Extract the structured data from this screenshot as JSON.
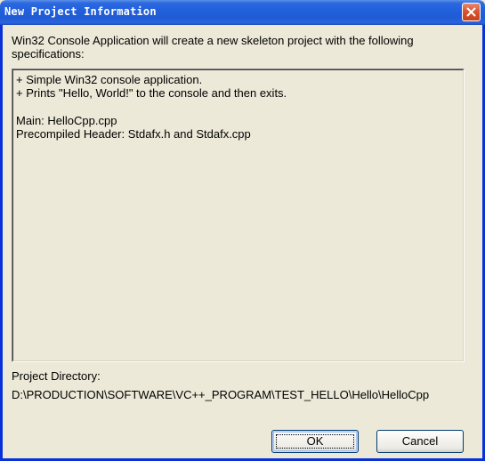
{
  "window": {
    "title": "New Project Information"
  },
  "intro": {
    "text": "Win32 Console Application will create a new skeleton project with the following specifications:"
  },
  "specs": {
    "lines": [
      "+ Simple Win32 console application.",
      "+ Prints \"Hello, World!\" to the console and then exits.",
      "",
      "Main: HelloCpp.cpp",
      "Precompiled Header: Stdafx.h and Stdafx.cpp"
    ]
  },
  "project_directory": {
    "label": "Project Directory:",
    "value": "D:\\PRODUCTION\\SOFTWARE\\VC++_PROGRAM\\TEST_HELLO\\Hello\\HelloCpp"
  },
  "buttons": {
    "ok_label": "OK",
    "cancel_label": "Cancel"
  },
  "icons": {
    "close": "close-icon"
  },
  "colors": {
    "titlebar": "#2260dc",
    "dialog_bg": "#ece9d8",
    "close_button": "#d9542f"
  }
}
